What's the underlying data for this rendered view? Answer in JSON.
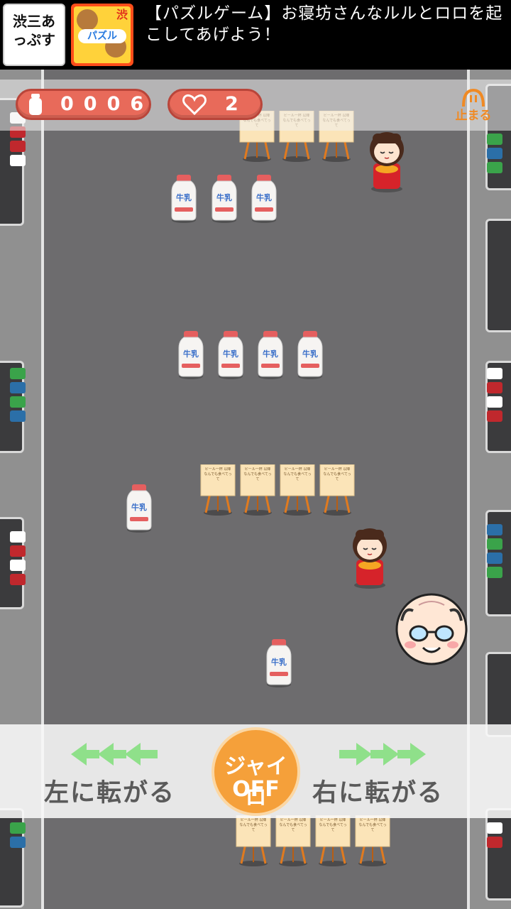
{
  "ad": {
    "text": "【パズルゲーム】お寝坊さんなルルとロロを起こしてあげよう！",
    "icon1_text": "渋三あっぷす",
    "icon2_text": "パズル",
    "icon2_badge": "渋"
  },
  "hud": {
    "milk_count": "0006",
    "lives": "2",
    "pause_label": "止まる"
  },
  "controls": {
    "left_label": "左に転がる",
    "right_label": "右に転がる",
    "gyro_line1": "ジャイロ",
    "gyro_line2": "OFF"
  },
  "milk_label": "牛乳",
  "sign_text": "ビール一杯 以降 なんでも食べてって",
  "colors": {
    "accent_red": "#e86a5a",
    "gyro_orange": "#f5a03a",
    "arrow_green": "#8fe08a",
    "road_gray": "#6d6c6e"
  }
}
